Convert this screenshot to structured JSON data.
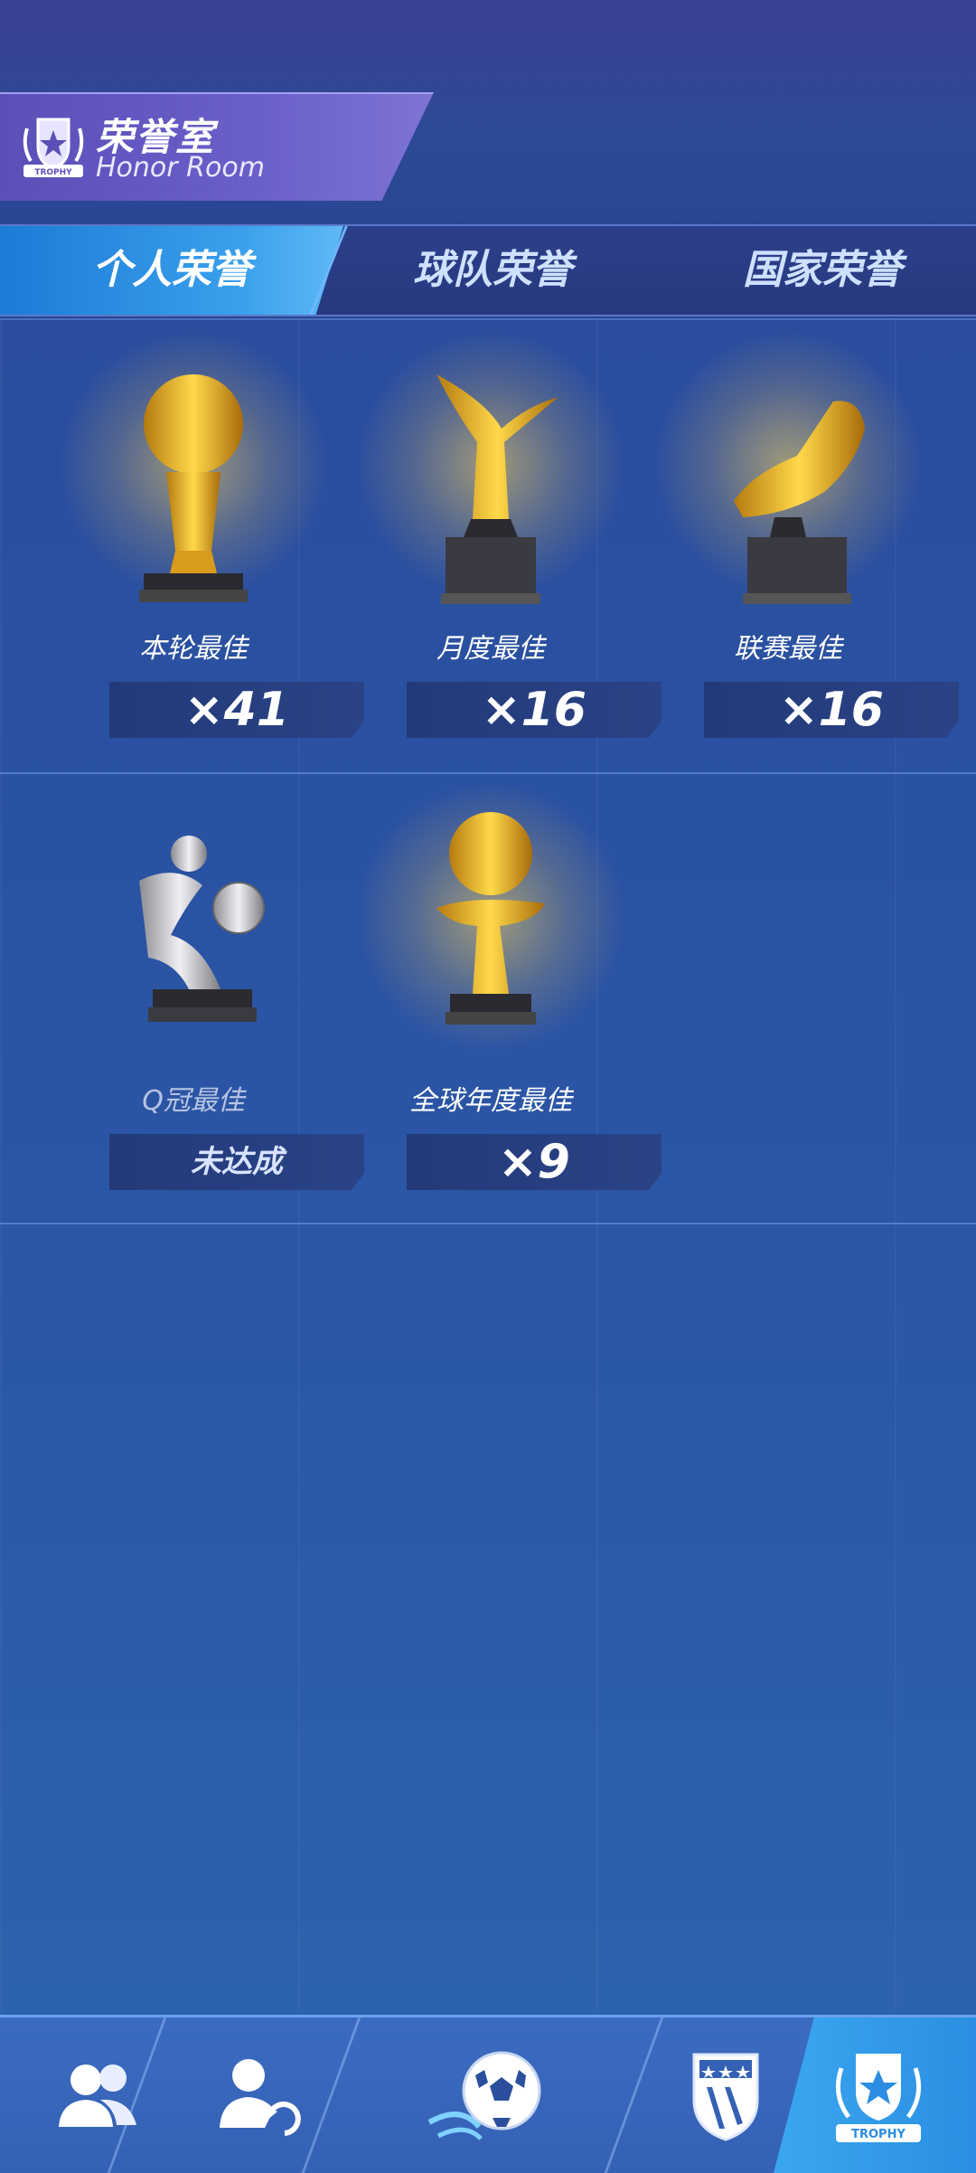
{
  "header": {
    "title_cn": "荣誉室",
    "title_en": "Honor Room",
    "emblem_icon": "trophy-emblem-icon",
    "emblem_text": "TROPHY"
  },
  "tabs": [
    {
      "label": "个人荣誉",
      "active": true
    },
    {
      "label": "球队荣誉",
      "active": false
    },
    {
      "label": "国家荣誉",
      "active": false
    }
  ],
  "honors": [
    {
      "label": "本轮最佳",
      "count": "×41",
      "trophy": "gold-ball-trophy-icon",
      "achieved": true
    },
    {
      "label": "月度最佳",
      "count": "×16",
      "trophy": "gold-monthly-trophy-icon",
      "achieved": true
    },
    {
      "label": "联赛最佳",
      "count": "×16",
      "trophy": "gold-boot-trophy-icon",
      "achieved": true
    },
    {
      "label": "Q冠最佳",
      "count": "未达成",
      "trophy": "silver-player-trophy-icon",
      "achieved": false
    },
    {
      "label": "全球年度最佳",
      "count": "×9",
      "trophy": "gold-ball-boot-trophy-icon",
      "achieved": true
    }
  ],
  "bottom_nav": [
    {
      "name": "players",
      "icon": "players-icon"
    },
    {
      "name": "transfer",
      "icon": "player-swap-icon"
    },
    {
      "name": "match",
      "icon": "soccer-ball-icon"
    },
    {
      "name": "club",
      "icon": "club-badge-icon"
    },
    {
      "name": "trophy",
      "icon": "trophy-emblem-icon",
      "label": "TROPHY",
      "active": true
    }
  ],
  "colors": {
    "accent": "#3aa0ec",
    "gold": "#f2c230",
    "panel": "#2a4d9e"
  }
}
